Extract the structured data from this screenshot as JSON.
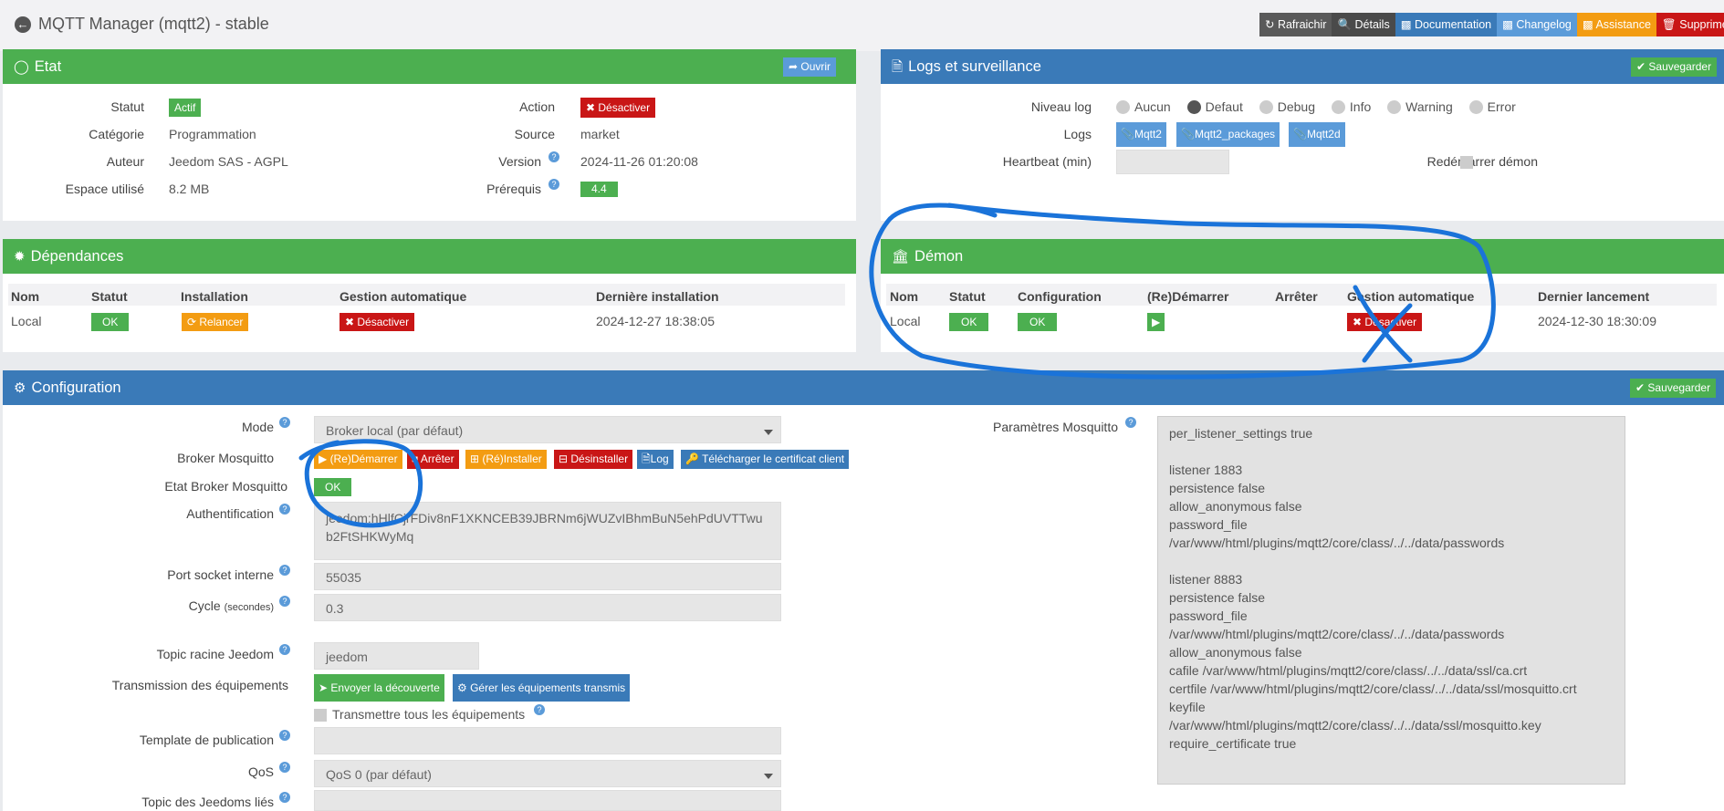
{
  "page": {
    "title": "MQTT Manager (mqtt2) - stable"
  },
  "toolbar": {
    "refresh": "Rafraichir",
    "details": "Détails",
    "documentation": "Documentation",
    "changelog": "Changelog",
    "assistance": "Assistance",
    "delete": "Supprimer"
  },
  "etat": {
    "title": "Etat",
    "open_btn": "Ouvrir",
    "statut_label": "Statut",
    "statut_value": "Actif",
    "categorie_label": "Catégorie",
    "categorie_value": "Programmation",
    "auteur_label": "Auteur",
    "auteur_value": "Jeedom SAS - AGPL",
    "espace_label": "Espace utilisé",
    "espace_value": "8.2 MB",
    "action_label": "Action",
    "action_btn": "Désactiver",
    "source_label": "Source",
    "source_value": "market",
    "version_label": "Version",
    "version_value": "2024-11-26 01:20:08",
    "prerequis_label": "Prérequis",
    "prerequis_value": "4.4"
  },
  "logs": {
    "title": "Logs et surveillance",
    "save_btn": "Sauvegarder",
    "niveau_label": "Niveau log",
    "levels": [
      "Aucun",
      "Defaut",
      "Debug",
      "Info",
      "Warning",
      "Error"
    ],
    "selected_level": "Defaut",
    "logs_label": "Logs",
    "log_buttons": [
      "Mqtt2",
      "Mqtt2_packages",
      "Mqtt2d"
    ],
    "heartbeat_label": "Heartbeat (min)",
    "restart_label": "Redémarrer démon"
  },
  "deps": {
    "title": "Dépendances",
    "headers": [
      "Nom",
      "Statut",
      "Installation",
      "Gestion automatique",
      "Dernière installation"
    ],
    "row": {
      "name": "Local",
      "status": "OK",
      "install_btn": "Relancer",
      "auto_btn": "Désactiver",
      "last": "2024-12-27 18:38:05"
    }
  },
  "demon": {
    "title": "Démon",
    "headers": [
      "Nom",
      "Statut",
      "Configuration",
      "(Re)Démarrer",
      "Arrêter",
      "Gestion automatique",
      "Dernier lancement"
    ],
    "row": {
      "name": "Local",
      "status": "OK",
      "config": "OK",
      "auto_btn": "Désactiver",
      "last": "2024-12-30 18:30:09"
    }
  },
  "config": {
    "title": "Configuration",
    "save_btn": "Sauvegarder",
    "mode_label": "Mode",
    "mode_value": "Broker local (par défaut)",
    "broker_label": "Broker Mosquitto",
    "broker_buttons": {
      "restart": "(Re)Démarrer",
      "stop": "Arrêter",
      "reinstall": "(Ré)Installer",
      "uninstall": "Désinstaller",
      "log": "Log",
      "cert": "Télécharger le certificat client"
    },
    "etat_label": "Etat Broker Mosquitto",
    "etat_value": "OK",
    "auth_label": "Authentification",
    "auth_value": "jeedom:hHlfCjrFDiv8nF1XKNCEB39JBRNm6jWUZvIBhmBuN5ehPdUVTTwub2FtSHKWyMq",
    "port_label": "Port socket interne",
    "port_value": "55035",
    "cycle_label": "Cycle",
    "cycle_unit": "(secondes)",
    "cycle_value": "0.3",
    "topic_label": "Topic racine Jeedom",
    "topic_value": "jeedom",
    "trans_label": "Transmission des équipements",
    "discover_btn": "Envoyer la découverte",
    "manage_btn": "Gérer les équipements transmis",
    "trans_all_label": "Transmettre tous les équipements",
    "template_label": "Template de publication",
    "qos_label": "QoS",
    "qos_value": "QoS 0 (par défaut)",
    "linked_label": "Topic des Jeedoms liés",
    "mosq_label": "Paramètres Mosquitto",
    "mosq_value": "per_listener_settings true\n\nlistener 1883\npersistence false\nallow_anonymous false\npassword_file\n/var/www/html/plugins/mqtt2/core/class/../../data/passwords\n\nlistener 8883\npersistence false\npassword_file\n/var/www/html/plugins/mqtt2/core/class/../../data/passwords\nallow_anonymous false\ncafile /var/www/html/plugins/mqtt2/core/class/../../data/ssl/ca.crt\ncertfile /var/www/html/plugins/mqtt2/core/class/../../data/ssl/mosquitto.crt\nkeyfile\n/var/www/html/plugins/mqtt2/core/class/../../data/ssl/mosquitto.key\nrequire_certificate true"
  },
  "colors": {
    "green": "#4caf50",
    "blue": "#3a7ab8",
    "red": "#c91616",
    "orange": "#f39c12",
    "annotation": "#1a73d9"
  }
}
